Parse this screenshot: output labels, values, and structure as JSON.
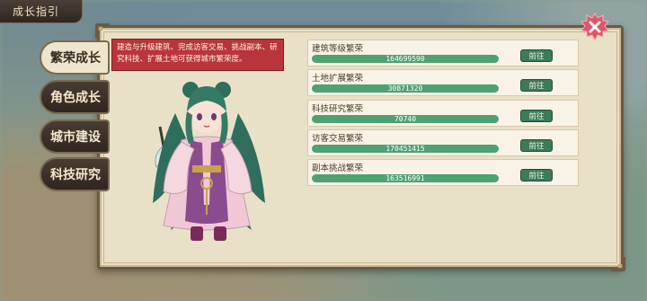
{
  "window": {
    "title": "成长指引"
  },
  "tabs": [
    {
      "label": "繁荣成长",
      "active": true
    },
    {
      "label": "角色成长",
      "active": false
    },
    {
      "label": "城市建设",
      "active": false
    },
    {
      "label": "科技研究",
      "active": false
    }
  ],
  "info": {
    "text": "建造与升级建筑、完成访客交易、挑战副本、研究科技、扩展土地可获得城市繁荣度。"
  },
  "rows": [
    {
      "label": "建筑等级繁荣",
      "value": "164699590",
      "button": "前往"
    },
    {
      "label": "土地扩展繁荣",
      "value": "30871320",
      "button": "前往"
    },
    {
      "label": "科技研究繁荣",
      "value": "70740",
      "button": "前往"
    },
    {
      "label": "访客交易繁荣",
      "value": "170451415",
      "button": "前往"
    },
    {
      "label": "副本挑战繁荣",
      "value": "163516991",
      "button": "前往"
    }
  ],
  "colors": {
    "accent": "#b9343b",
    "bar": "#4fa172",
    "button": "#3d7a58",
    "panel": "#e9e0c8"
  },
  "icons": {
    "close": "close-icon"
  }
}
